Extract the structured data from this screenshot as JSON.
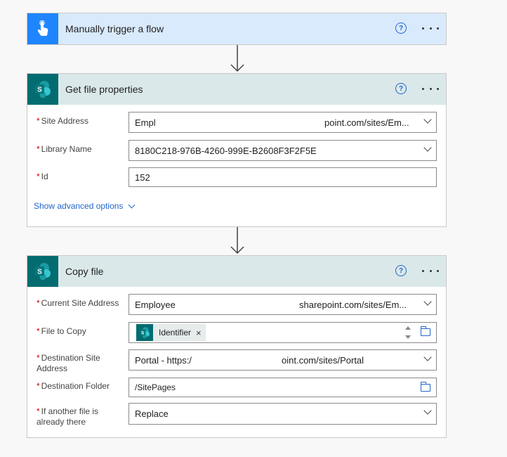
{
  "trigger": {
    "title": "Manually trigger a flow",
    "header_color": "#d9eafc",
    "icon_color": "#1f85ff",
    "help": "?"
  },
  "get_props": {
    "title": "Get file properties",
    "header_color": "#dae8e9",
    "icon_color": "#036c70",
    "help": "?",
    "fields": {
      "site_address": {
        "label": "Site Address",
        "value_start": "Empl",
        "value_end": "point.com/sites/Em..."
      },
      "library_name": {
        "label": "Library Name",
        "value": "8180C218-976B-4260-999E-B2608F3F2F5E"
      },
      "id": {
        "label": "Id",
        "value": "152"
      }
    },
    "advanced_label": "Show advanced options"
  },
  "copy_file": {
    "title": "Copy file",
    "header_color": "#dae8e9",
    "icon_color": "#036c70",
    "help": "?",
    "fields": {
      "current_site": {
        "label": "Current Site Address",
        "value_start": "Employee",
        "value_end": "sharepoint.com/sites/Em..."
      },
      "file_to_copy": {
        "label": "File to Copy",
        "token": "Identifier",
        "token_remove": "×"
      },
      "dest_site": {
        "label": "Destination Site Address",
        "value_start": "Portal - https:/",
        "value_end": "oint.com/sites/Portal"
      },
      "dest_folder": {
        "label": "Destination Folder",
        "value": "/SitePages"
      },
      "if_exists": {
        "label": "If another file is already there",
        "value": "Replace"
      }
    }
  },
  "required_marker": "*",
  "icons": {
    "trigger": "hand-tap-icon",
    "sharepoint": "sharepoint-icon",
    "connector": "arrow-down-icon"
  }
}
